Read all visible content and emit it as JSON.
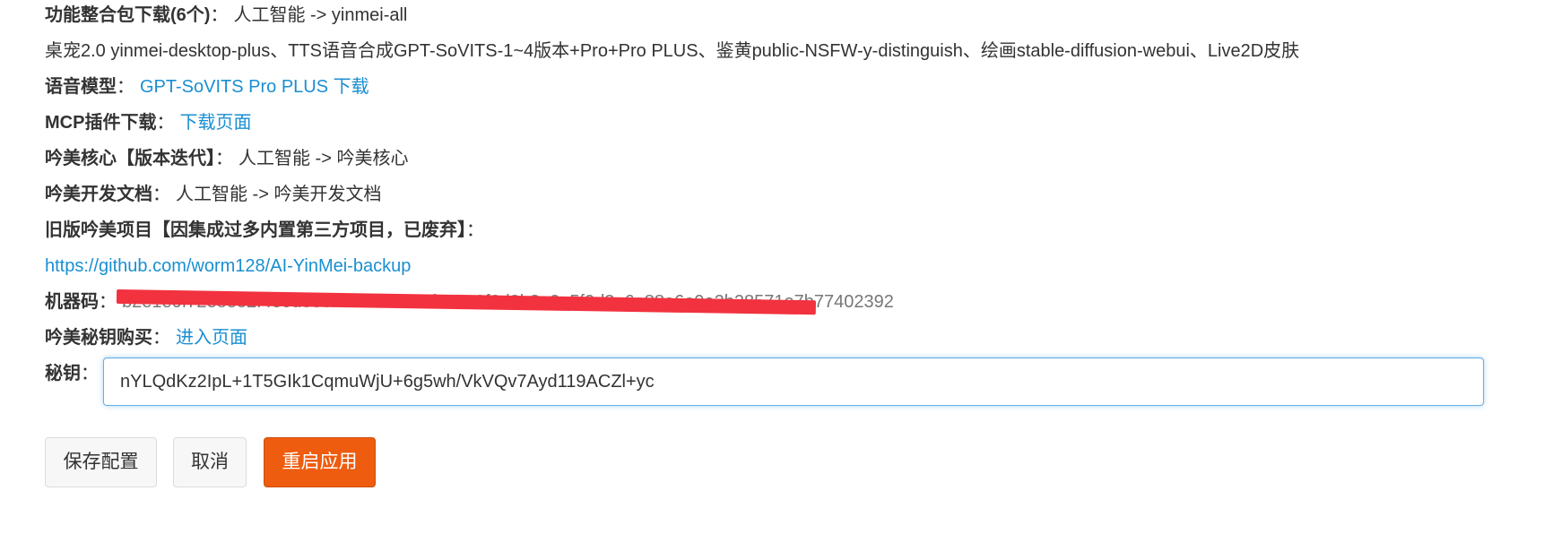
{
  "rows": {
    "bundle": {
      "label": "功能整合包下载(6个)",
      "colon": "：",
      "text": "人工智能 -> yinmei-all"
    },
    "bundle_desc": {
      "text": "桌宠2.0 yinmei-desktop-plus、TTS语音合成GPT-SoVITS-1~4版本+Pro+Pro PLUS、鉴黄public-NSFW-y-distinguish、绘画stable-diffusion-webui、Live2D皮肤"
    },
    "voice_model": {
      "label": "语音模型",
      "colon": "：",
      "link": "GPT-SoVITS Pro PLUS 下载"
    },
    "mcp": {
      "label": "MCP插件下载",
      "colon": "：",
      "link": "下载页面"
    },
    "core": {
      "label": "吟美核心【版本迭代】",
      "colon": "：",
      "text": "人工智能 -> 吟美核心"
    },
    "dev_docs": {
      "label": "吟美开发文档",
      "colon": "：",
      "text": "人工智能 -> 吟美开发文档"
    },
    "old_project": {
      "label": "旧版吟美项目【因集成过多内置第三方项目，已废弃】",
      "colon": "："
    },
    "old_project_link": {
      "link": "https://github.com/worm128/AI-YinMei-backup"
    },
    "machine_code": {
      "label": "机器码",
      "colon": "：",
      "value": "b2e1e0f72e8e82f4e0d8e0f4a5f7e1a20f0c2e9f6d8b8a2e5f9d3a6e88a6e9a2b28571e7b77402392"
    },
    "buy_key": {
      "label": "吟美秘钥购买",
      "colon": "：",
      "link": "进入页面"
    },
    "secret_key": {
      "label": "秘钥",
      "colon": "：",
      "value": "nYLQdKz2IpL+1T5GIk1CqmuWjU+6g5wh/VkVQv7Ayd119ACZl+yc"
    }
  },
  "buttons": {
    "save": "保存配置",
    "cancel": "取消",
    "restart": "重启应用"
  },
  "colors": {
    "link": "#1a8fd1",
    "primary_button": "#ee5c0f",
    "redaction": "#f2323f"
  }
}
